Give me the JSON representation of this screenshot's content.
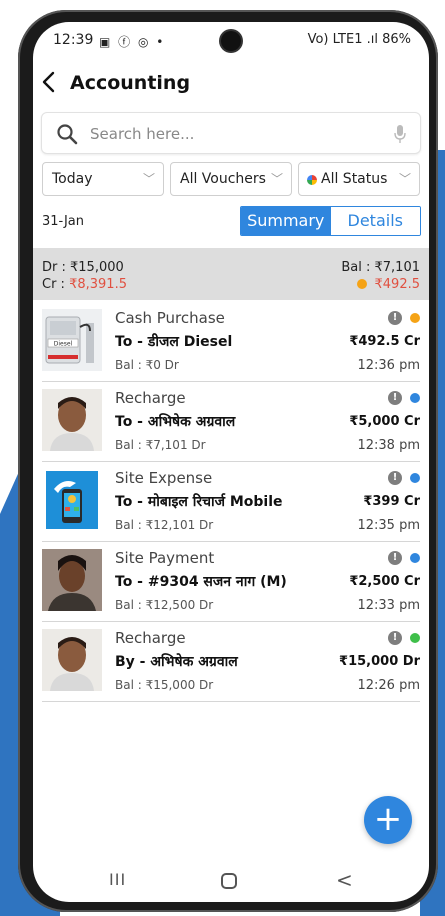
{
  "status_bar": {
    "time": "12:39",
    "left_icons": "▣ ⓕ ◎ •",
    "right_text": "Vo) LTE1 .ıl 86%"
  },
  "header": {
    "title": "Accounting"
  },
  "search": {
    "placeholder": "Search here..."
  },
  "filters": {
    "date": "Today",
    "vouchers": "All Vouchers",
    "status": "All Status"
  },
  "date_label": "31-Jan",
  "view_toggle": {
    "summary": "Summary",
    "details": "Details",
    "active": "Summary"
  },
  "summary": {
    "dr": "Dr : ₹15,000",
    "cr_label": "Cr : ",
    "cr_value": "₹8,391.5",
    "bal": "Bal : ₹7,101",
    "pending": "₹492.5",
    "pending_color": "#f5a316"
  },
  "transactions": [
    {
      "type": "Cash Purchase",
      "party": "To - डीजल Diesel",
      "balance": "Bal : ₹0 Dr",
      "amount": "₹492.5 Cr",
      "time": "12:36 pm",
      "status_color": "#f5a316",
      "thumb": "diesel-pump-icon"
    },
    {
      "type": "Recharge",
      "party": "To - अभिषेक अग्रवाल",
      "balance": "Bal : ₹7,101 Dr",
      "amount": "₹5,000 Cr",
      "time": "12:38 pm",
      "status_color": "#2f86de",
      "thumb": "person-photo"
    },
    {
      "type": "Site Expense",
      "party": "To - मोबाइल रिचार्ज Mobile",
      "balance": "Bal : ₹12,101 Dr",
      "amount": "₹399 Cr",
      "time": "12:35 pm",
      "status_color": "#2f86de",
      "thumb": "mobile-recharge-icon"
    },
    {
      "type": "Site Payment",
      "party": "To - #9304 सजन नाग (M)",
      "balance": "Bal : ₹12,500 Dr",
      "amount": "₹2,500 Cr",
      "time": "12:33 pm",
      "status_color": "#2f86de",
      "thumb": "person-photo"
    },
    {
      "type": "Recharge",
      "party": "By - अभिषेक अग्रवाल",
      "balance": "Bal : ₹15,000 Dr",
      "amount": "₹15,000 Dr",
      "time": "12:26 pm",
      "status_color": "#3fbf4a",
      "thumb": "person-photo"
    }
  ],
  "fab": {
    "label": "+"
  },
  "nav": {
    "recents": "III",
    "back": "<"
  }
}
